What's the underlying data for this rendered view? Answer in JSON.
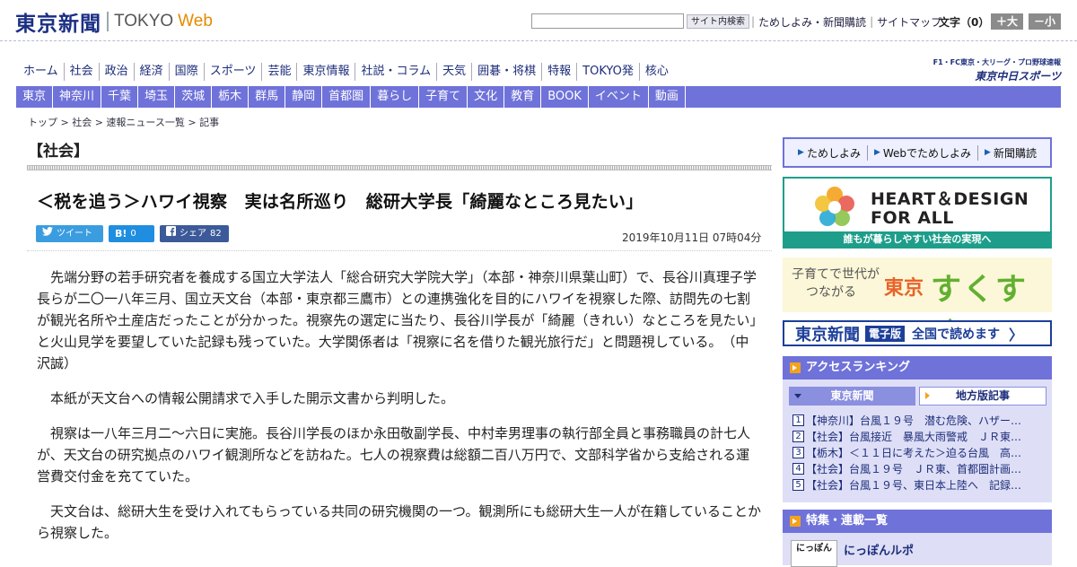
{
  "header": {
    "logo_kanji": "東京新聞",
    "logo_tokyo": "TOKYO",
    "logo_web": "Web",
    "search_placeholder": "",
    "search_button": "サイト内検索",
    "links": [
      "ためしよみ・新聞購読",
      "サイトマップ"
    ],
    "fontsize_label": "文字（0）",
    "font_large": "＋大",
    "font_small": "－小"
  },
  "main_nav": [
    "ホーム",
    "社会",
    "政治",
    "経済",
    "国際",
    "スポーツ",
    "芸能",
    "東京情報",
    "社説・コラム",
    "天気",
    "囲碁・将棋",
    "特報",
    "TOKYO発",
    "核心"
  ],
  "chunichi": {
    "line1": "F1・FC東京・大リーグ・プロ野球速報",
    "line2": "東京中日スポーツ"
  },
  "sub_nav": [
    "東京",
    "神奈川",
    "千葉",
    "埼玉",
    "茨城",
    "栃木",
    "群馬",
    "静岡",
    "首都圏",
    "暮らし",
    "子育て",
    "文化",
    "教育",
    "BOOK",
    "イベント",
    "動画"
  ],
  "breadcrumb": "トップ > 社会 > 速報ニュース一覧 > 記事",
  "section_title": "【社会】",
  "headline": "＜税を追う＞ハワイ視察　実は名所巡り　総研大学長「綺麗なところ見たい」",
  "share": {
    "tweet": "ツイート",
    "hatena_label": "B!",
    "hatena_count": "0",
    "fb_label": "シェア",
    "fb_count": "82"
  },
  "pubdate": "2019年10月11日 07時04分",
  "article": [
    "先端分野の若手研究者を養成する国立大学法人「総合研究大学院大学」（本部・神奈川県葉山町）で、長谷川真理子学長らが二〇一八年三月、国立天文台（本部・東京都三鷹市）との連携強化を目的にハワイを視察した際、訪問先の七割が観光名所や土産店だったことが分かった。視察先の選定に当たり、長谷川学長が「綺麗（きれい）なところを見たい」と火山見学を要望していた記録も残っていた。大学関係者は「視察に名を借りた観光旅行だ」と問題視している。　（中沢誠）",
    "本紙が天文台への情報公開請求で入手した開示文書から判明した。",
    "視察は一八年三月二～六日に実施。長谷川学長のほか永田敬副学長、中村幸男理事の執行部全員と事務職員の計七人が、天文台の研究拠点のハワイ観測所などを訪ねた。七人の視察費は総額二百八万円で、文部科学省から支給される運営費交付金を充てていた。",
    "天文台は、総研大生を受け入れてもらっている共同の研究機関の一つ。観測所にも総研大生一人が在籍していることから視察した。"
  ],
  "sidebar": {
    "subscribe": [
      "ためしよみ",
      "Webでためしよみ",
      "新聞購読"
    ],
    "heart_line1": "HEART＆DESIGN",
    "heart_line2": "FOR ALL",
    "heart_footer": "誰もが暮らしやすい社会の実現へ",
    "suku_line1": "子育てで世代が",
    "suku_line2": "つながる",
    "suku_tokyo": "東京",
    "suku_main": "すくすく",
    "denshi_logo": "東京新聞",
    "denshi_badge": "電子版",
    "denshi_text": "全国で読めます",
    "denshi_arrow": "〉",
    "ranking_title": "アクセスランキング",
    "ranking_tab1": "東京新聞",
    "ranking_tab2": "地方版記事",
    "ranking": [
      {
        "num": "1",
        "text": "【神奈川】台風１９号　潜む危険、ハザー…"
      },
      {
        "num": "2",
        "text": "【社会】台風接近　暴風大雨警戒　ＪＲ東…"
      },
      {
        "num": "3",
        "text": "【栃木】＜１１日に考えた＞迫る台風　高…"
      },
      {
        "num": "4",
        "text": "【社会】台風１９号　ＪＲ東、首都圏計画…"
      },
      {
        "num": "5",
        "text": "【社会】台風１９号、東日本上陸へ　記録…"
      }
    ],
    "features_title": "特集・連載一覧",
    "feature_thumb": "にっぽん",
    "feature_item": "にっぽんルポ"
  },
  "colors": {
    "nav_purple": "#6f72d9",
    "teal": "#1e9e8a",
    "navy": "#1d2d7a",
    "orange": "#e58a00"
  }
}
